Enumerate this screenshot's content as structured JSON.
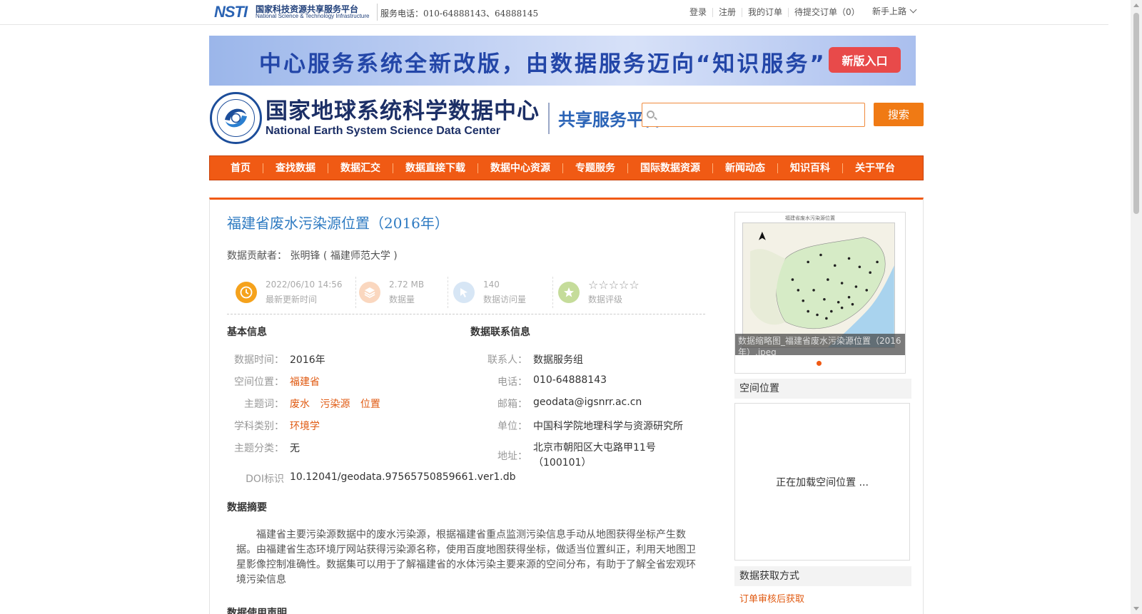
{
  "topbar": {
    "logo_mark": "NSTI",
    "logo_cn": "国家科技资源共享服务平台",
    "logo_en": "National Science & Technology Infrastructure",
    "hotline": "服务电话：010-64888143、64888145",
    "links": [
      "登录",
      "注册",
      "我的订单",
      "待提交订单（0）"
    ],
    "newbie": "新手上路"
  },
  "banner": {
    "text": "中心服务系统全新改版，由数据服务迈向“知识服务”",
    "button": "新版入口"
  },
  "header": {
    "brand_cn": "国家地球系统科学数据中心",
    "brand_en": "National Earth System Science Data Center",
    "brand_sub": "共享服务平台",
    "search_placeholder": "",
    "search_button": "搜索"
  },
  "nav": [
    "首页",
    "查找数据",
    "数据汇交",
    "数据直接下载",
    "数据中心资源",
    "专题服务",
    "国际数据资源",
    "新闻动态",
    "知识百科",
    "关于平台"
  ],
  "dataset": {
    "title": "福建省废水污染源位置（2016年）",
    "contributor_label": "数据贡献者：",
    "contributor": "张明锋 ( 福建师范大学 )",
    "stats": {
      "updated": "2022/06/10 14:56",
      "updated_label": "最新更新时间",
      "size": "2.72 MB",
      "size_label": "数据量",
      "visits": "140",
      "visits_label": "数据访问量",
      "rating": "☆☆☆☆☆",
      "rating_label": "数据评级",
      "rating_value": 0
    },
    "basic": {
      "heading": "基本信息",
      "time_label": "数据时间：",
      "time": "2016年",
      "space_label": "空间位置：",
      "space": "福建省",
      "keywords_label": "主题词：",
      "keywords": [
        "废水",
        "污染源",
        "位置"
      ],
      "discipline_label": "学科类别：",
      "discipline": "环境学",
      "topic_label": "主题分类：",
      "topic": "无",
      "doi_label": "DOI标识",
      "doi": "10.12041/geodata.97565750859661.ver1.db"
    },
    "contact": {
      "heading": "数据联系信息",
      "person_label": "联系人：",
      "person": "数据服务组",
      "phone_label": "电话：",
      "phone": "010-64888143",
      "email_label": "邮箱：",
      "email": "geodata@igsnrr.ac.cn",
      "unit_label": "单位：",
      "unit": "中国科学院地理科学与资源研究所",
      "address_label": "地址：",
      "address": "北京市朝阳区大屯路甲11号（100101）"
    },
    "abstract_heading": "数据摘要",
    "abstract": "福建省主要污染源数据中的废水污染源，根据福建省重点监测污染信息手动从地图获得坐标产生数据。由福建省生态环境厅网站获得污染源名称，使用百度地图获得坐标，做适当位置纠正，利用天地图卫星影像控制准确性。数据集可以用于了解福建省的水体污染主要来源的空间分布，有助于了解全省宏观环境污染信息",
    "usage_heading": "数据使用声明"
  },
  "sidebar": {
    "thumb_title": "福建省废水污染源位置",
    "thumb_caption": "数据缩略图_福建省废水污染源位置（2016年）.jpeg",
    "space_heading": "空间位置",
    "space_loading": "正在加载空间位置 ...",
    "access_heading": "数据获取方式",
    "access_link": "订单审核后获取"
  },
  "colors": {
    "accent": "#f05a14",
    "title_blue": "#2f7bc2",
    "link_orange": "#e05a12",
    "brand_navy": "#1c2f66"
  }
}
